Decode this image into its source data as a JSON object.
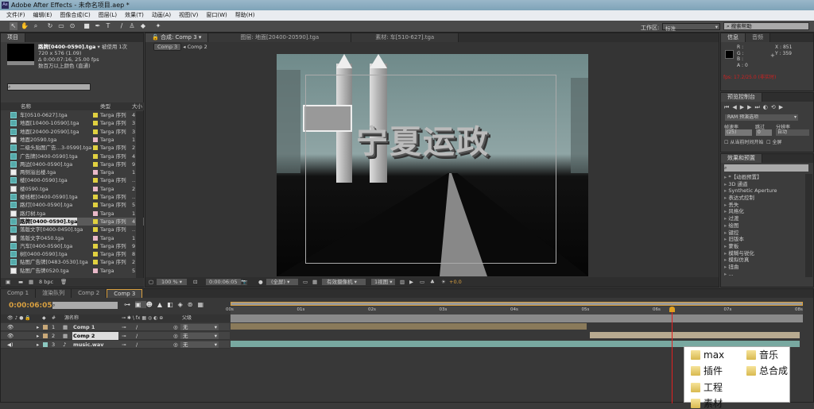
{
  "window": {
    "title": "Adobe After Effects - 未命名项目.aep *",
    "app_icon": "Ae"
  },
  "menu": [
    "文件(F)",
    "编辑(E)",
    "图像合成(C)",
    "图层(L)",
    "效果(T)",
    "动画(A)",
    "视图(V)",
    "窗口(W)",
    "帮助(H)"
  ],
  "toolbar": {
    "workspace_label": "工作区:",
    "workspace_value": "标准",
    "search_placeholder": "搜索帮助"
  },
  "project": {
    "tab": "项目",
    "selected_name": "路牌[0400-0590].tga",
    "used": "▾ 被使用 1次",
    "dims": "720 x 576 (1.09)",
    "duration": "Δ 0:00:07:16, 25.00 fps",
    "color": "数百万以上颜色 (直通)",
    "columns": {
      "name": "名称",
      "type": "类型",
      "size": "大小"
    },
    "items": [
      {
        "name": "车[0510-0627].tga",
        "type": "Targa 序列",
        "size": "4",
        "label": "#e0d040",
        "seq": true
      },
      {
        "name": "地面[10400-10590].tga",
        "type": "Targa 序列",
        "size": "3",
        "label": "#e0d040",
        "seq": true
      },
      {
        "name": "地面[20400-20590].tga",
        "type": "Targa 序列",
        "size": "3",
        "label": "#e0d040",
        "seq": true
      },
      {
        "name": "地面20590.tga",
        "type": "Targa",
        "size": "1",
        "label": "#e8b8c8",
        "seq": false
      },
      {
        "name": "二级头贴图广告…3-0599].tga",
        "type": "Targa 序列",
        "size": "2",
        "label": "#e0d040",
        "seq": true
      },
      {
        "name": "广告牌[0400-0590].tga",
        "type": "Targa 序列",
        "size": "4",
        "label": "#e0d040",
        "seq": true
      },
      {
        "name": "两边[0400-0590].tga",
        "type": "Targa 序列",
        "size": "9",
        "label": "#e0d040",
        "seq": true
      },
      {
        "name": "两侧溢出楼.tga",
        "type": "Targa",
        "size": "1",
        "label": "#e8b8c8",
        "seq": false
      },
      {
        "name": "楼[0400-0590].tga",
        "type": "Targa 序列",
        "size": "..",
        "label": "#e0d040",
        "seq": true
      },
      {
        "name": "楼0590.tga",
        "type": "Targa",
        "size": "2",
        "label": "#e8b8c8",
        "seq": false
      },
      {
        "name": "楼线框[0400-0590].tga",
        "type": "Targa 序列",
        "size": "..",
        "label": "#e0d040",
        "seq": true
      },
      {
        "name": "路灯[0400-0590].tga",
        "type": "Targa 序列",
        "size": "5",
        "label": "#e0d040",
        "seq": true
      },
      {
        "name": "路灯树.tga",
        "type": "Targa",
        "size": "1",
        "label": "#e8b8c8",
        "seq": false
      },
      {
        "name": "路牌[0400-0590].tga",
        "type": "Targa 序列",
        "size": "4",
        "label": "#e0d040",
        "seq": true,
        "selected": true
      },
      {
        "name": "落版文字[0400-0450].tga",
        "type": "Targa 序列",
        "size": "..",
        "label": "#e0d040",
        "seq": true
      },
      {
        "name": "落版文字0450.tga",
        "type": "Targa",
        "size": "1",
        "label": "#e8b8c8",
        "seq": false
      },
      {
        "name": "汽车[0400-0590].tga",
        "type": "Targa 序列",
        "size": "9",
        "label": "#e0d040",
        "seq": true
      },
      {
        "name": "树[0400-0590].tga",
        "type": "Targa 序列",
        "size": "8",
        "label": "#e0d040",
        "seq": true
      },
      {
        "name": "贴图广告牌[0483-0530].tga",
        "type": "Targa 序列",
        "size": "2",
        "label": "#e0d040",
        "seq": true
      },
      {
        "name": "贴图广告牌0520.tga",
        "type": "Targa",
        "size": "5",
        "label": "#e8b8c8",
        "seq": false
      }
    ],
    "footer_bpc": "8 bpc"
  },
  "viewer": {
    "tabs": [
      "合成: Comp 3",
      "图层: 地面[20400-20590].tga",
      "素材: 车[510-627].tga"
    ],
    "breadcrumb": [
      "Comp 3",
      "Comp 2"
    ],
    "title_text": "宁夏运政",
    "footer": {
      "zoom": "100 %",
      "timecode": "0:00:06:05",
      "resolution": "(全屏)",
      "camera": "有效摄像机",
      "views": "1视图",
      "exposure": "+0.0"
    }
  },
  "info": {
    "tabs": [
      "信息",
      "音频"
    ],
    "r": "R :",
    "g": "G :",
    "b": "B :",
    "a": "A : 0",
    "x": "X : 851",
    "y": "Y : 359",
    "fps": "fps: 17.2/25.0 (非实时)"
  },
  "preview": {
    "tab": "预览控制台",
    "ram": "RAM 预演选项",
    "frame_rate_label": "帧速率",
    "skip_label": "跳过",
    "resolution_label": "分辨率",
    "frame_rate": "(25)",
    "skip": "0",
    "resolution": "自动",
    "from_current": "从当前时间开始",
    "fullscreen": "全屏"
  },
  "effects": {
    "tab": "效果和预置",
    "items": [
      "*【动画预置】",
      "3D 通道",
      "Synthetic Aperture",
      "表达式控制",
      "丢失",
      "风格化",
      "过渡",
      "绘图",
      "键控",
      "旧版本",
      "蒙板",
      "模糊与锐化",
      "模拟仿真",
      "扭曲",
      "..."
    ]
  },
  "timeline": {
    "tabs": [
      "Comp 1",
      "渲染队列",
      "Comp 2",
      "Comp 3"
    ],
    "active_tab": 3,
    "timecode": "0:00:06:05",
    "column_source": "源名称",
    "column_parent": "父级",
    "ruler": [
      "00s",
      "01s",
      "02s",
      "03s",
      "04s",
      "05s",
      "06s",
      "07s",
      "08s"
    ],
    "current_time_s": 6.2,
    "duration_s": 8,
    "layers": [
      {
        "num": "1",
        "name": "Comp 1",
        "parent": "无",
        "color": "#c8a878",
        "bar_color": "#8a7a5a",
        "in_s": 0,
        "out_s": 5.0
      },
      {
        "num": "2",
        "name": "Comp 2",
        "parent": "无",
        "color": "#c8a878",
        "bar_color": "#b8aa90",
        "in_s": 5.05,
        "out_s": 8
      },
      {
        "num": "3",
        "name": "music.wav",
        "parent": "无",
        "color": "#8cc8c0",
        "bar_color": "#78a8a0",
        "in_s": 0,
        "out_s": 8
      }
    ]
  },
  "explorer_overlay": {
    "folders": [
      "max",
      "音乐",
      "插件",
      "总合成",
      "工程",
      "素材"
    ]
  }
}
